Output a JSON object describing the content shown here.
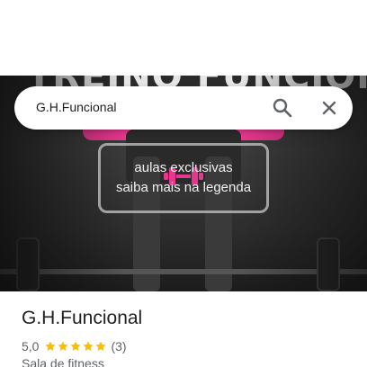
{
  "search": {
    "query": "G.H.Funcional"
  },
  "hero": {
    "banner_text": "TREINO FUNCIONAL",
    "promo_line_1": "aulas exclusivas",
    "promo_line_2": "saiba mais na legenda",
    "accent_color": "#e8368e"
  },
  "place": {
    "name": "G.H.Funcional",
    "rating": "5,0",
    "stars": 5,
    "reviews": "(3)",
    "category": "Sala de fitness",
    "star_color": "#fbbc04"
  },
  "icons": {
    "search": "search-icon",
    "close": "close-icon",
    "dumbbell": "dumbbell-icon",
    "star": "star-icon"
  }
}
